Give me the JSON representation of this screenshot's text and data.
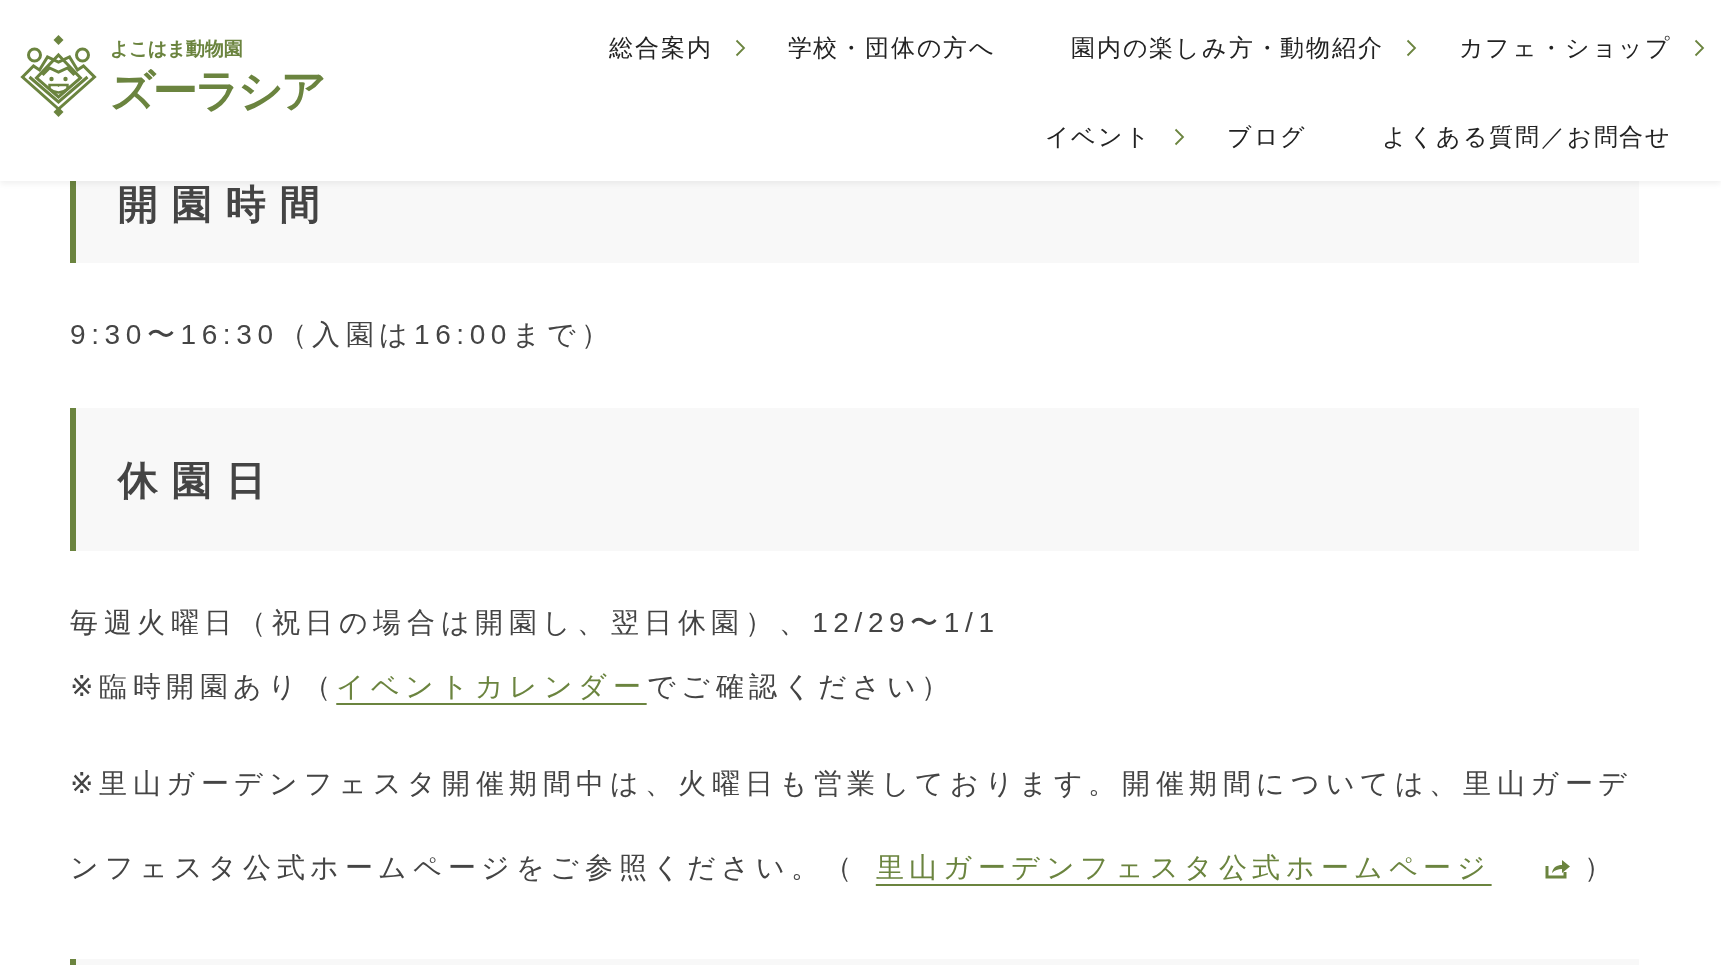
{
  "logo": {
    "subtitle": "よこはま動物園",
    "name": "ズーラシア"
  },
  "nav": {
    "items": [
      {
        "label": "総合案内",
        "submenu": true
      },
      {
        "label": "学校・団体の方へ",
        "submenu": false
      },
      {
        "label": "園内の楽しみ方・動物紹介",
        "submenu": true
      },
      {
        "label": "カフェ・ショップ",
        "submenu": true
      },
      {
        "label": "イベント",
        "submenu": true
      },
      {
        "label": "ブログ",
        "submenu": false
      },
      {
        "label": "よくある質問／お問合せ",
        "submenu": false
      }
    ]
  },
  "sections": [
    {
      "heading": "開園時間",
      "blocks": [
        {
          "kind": "compact",
          "lines": [
            {
              "parts": [
                {
                  "kind": "text",
                  "text": "9:30〜16:30（入園は16:00まで）"
                }
              ]
            }
          ]
        }
      ]
    },
    {
      "heading": "休園日",
      "blocks": [
        {
          "kind": "compact",
          "lines": [
            {
              "parts": [
                {
                  "kind": "text",
                  "text": "毎週火曜日（祝日の場合は開園し、翌日休園）、12/29〜1/1"
                }
              ]
            },
            {
              "parts": [
                {
                  "kind": "text",
                  "text": "※臨時開園あり（"
                },
                {
                  "kind": "link",
                  "text": "イベントカレンダー",
                  "external": false
                },
                {
                  "kind": "text",
                  "text": "でご確認ください）"
                }
              ]
            }
          ]
        },
        {
          "kind": "spaced",
          "lines": [
            {
              "parts": [
                {
                  "kind": "text",
                  "text": "※里山ガーデンフェスタ開催期間中は、火曜日も営業しております。開催期間については、里山ガーデンフェスタ公式ホームページをご参照ください。（"
                },
                {
                  "kind": "link",
                  "text": "里山ガーデンフェスタ公式ホームページ",
                  "external": true
                },
                {
                  "kind": "text",
                  "text": "）"
                }
              ]
            }
          ]
        }
      ]
    }
  ]
}
